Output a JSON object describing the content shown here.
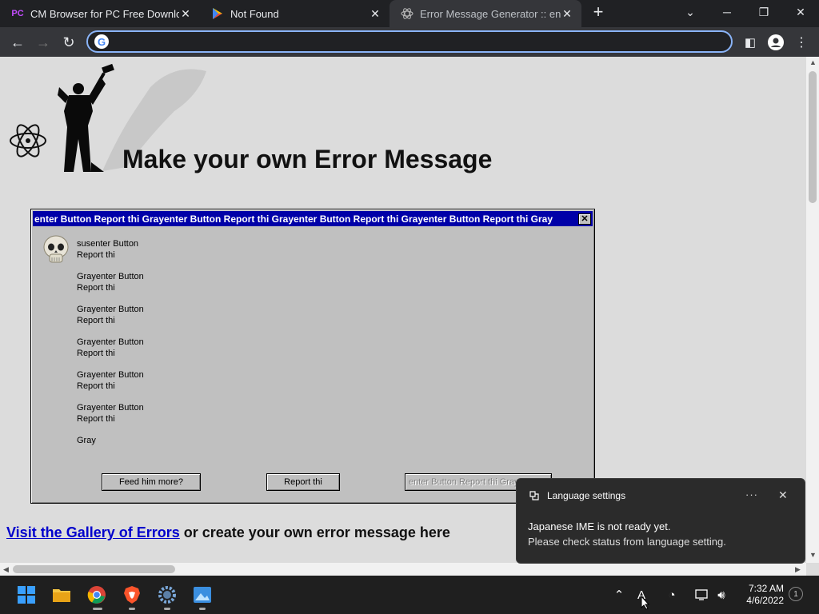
{
  "tabs": [
    {
      "title": "CM Browser for PC Free Downloa",
      "favicon": "PC"
    },
    {
      "title": "Not Found",
      "favicon": "play-store-icon"
    },
    {
      "title": "Error Message Generator :: enter",
      "favicon": "atom-icon"
    }
  ],
  "omnibox": {
    "value": "",
    "placeholder": ""
  },
  "page": {
    "title": "Make your own Error Message",
    "gallery_link": "Visit the Gallery of Errors",
    "gallery_rest": " or create your own error message here"
  },
  "dialog": {
    "title": "enter Button Report thi  Grayenter Button Report thi  Grayenter Button Report thi  Grayenter Button Report thi  Gray",
    "messages": [
      "susenter Button\nReport thi",
      "Grayenter Button\nReport thi",
      "Grayenter Button\nReport thi",
      "Grayenter Button\nReport thi",
      "Grayenter Button\nReport thi",
      "Grayenter Button\nReport thi",
      "Gray"
    ],
    "buttons": [
      "Feed him more?",
      "Report thi",
      "enter Button Report thi  Gray"
    ]
  },
  "notification": {
    "app": "Language settings",
    "line1": "Japanese IME is not ready yet.",
    "line2": "Please check status from language setting."
  },
  "taskbar": {
    "clock_time": "7:32 AM",
    "clock_date": "4/6/2022",
    "notif_count": "1"
  },
  "colors": {
    "dialog_title": "#0000a8",
    "dialog_body": "#c0c0c0",
    "link": "#0000cc",
    "omnibox_focus": "#8ab4f8"
  }
}
